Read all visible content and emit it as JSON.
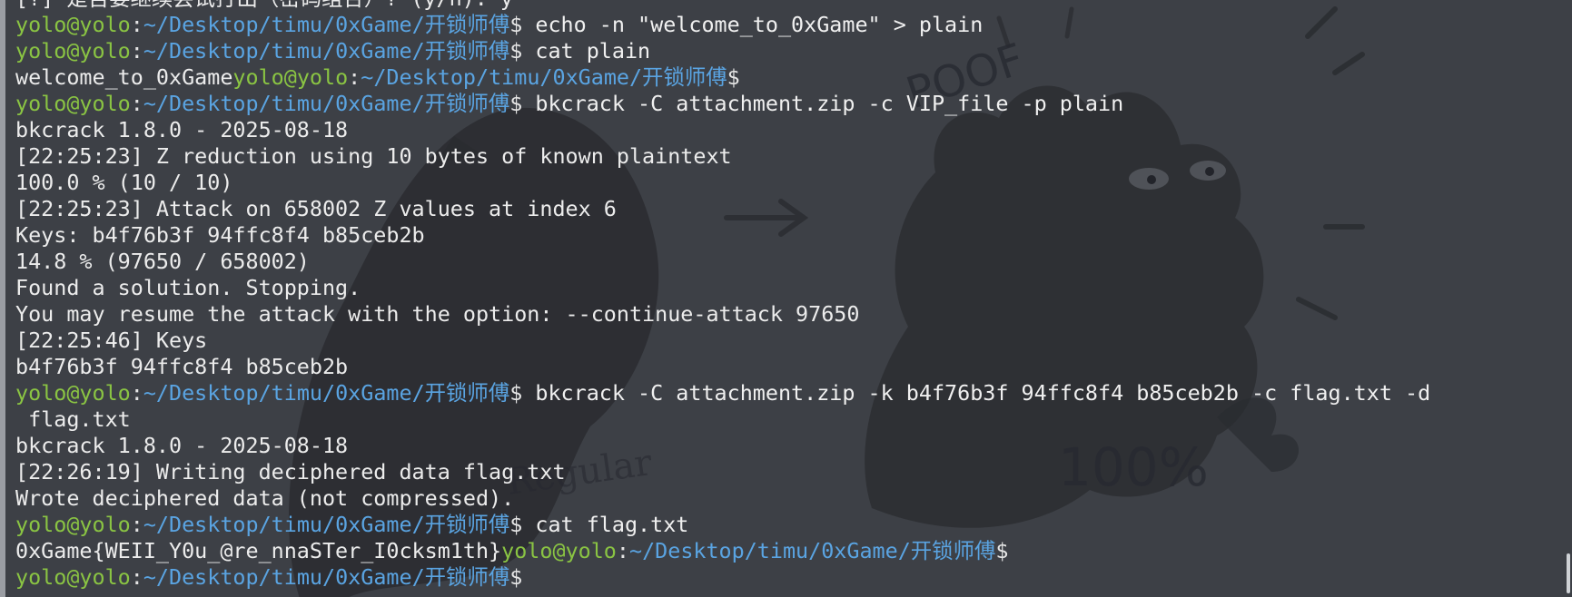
{
  "prompt": {
    "user_host": "yolo@yolo",
    "separator": ":",
    "path": "~/Desktop/timu/0xGame/开锁师傅",
    "symbol": "$"
  },
  "lines": [
    {
      "type": "text",
      "text": "[?] 是否要继续尝试打出（密码组合）? (y/n): y"
    },
    {
      "type": "prompt",
      "cmd": " echo -n \"welcome_to_0xGame\" > plain"
    },
    {
      "type": "prompt",
      "cmd": " cat plain"
    },
    {
      "type": "output_prompt",
      "text": "welcome_to_0xGame",
      "cmd": ""
    },
    {
      "type": "prompt",
      "cmd": " bkcrack -C attachment.zip -c VIP_file -p plain"
    },
    {
      "type": "text",
      "text": "bkcrack 1.8.0 - 2025-08-18"
    },
    {
      "type": "text",
      "text": "[22:25:23] Z reduction using 10 bytes of known plaintext"
    },
    {
      "type": "text",
      "text": "100.0 % (10 / 10)"
    },
    {
      "type": "text",
      "text": "[22:25:23] Attack on 658002 Z values at index 6"
    },
    {
      "type": "text",
      "text": "Keys: b4f76b3f 94ffc8f4 b85ceb2b"
    },
    {
      "type": "text",
      "text": "14.8 % (97650 / 658002)"
    },
    {
      "type": "text",
      "text": "Found a solution. Stopping."
    },
    {
      "type": "text",
      "text": "You may resume the attack with the option: --continue-attack 97650"
    },
    {
      "type": "text",
      "text": "[22:25:46] Keys"
    },
    {
      "type": "text",
      "text": "b4f76b3f 94ffc8f4 b85ceb2b"
    },
    {
      "type": "prompt",
      "cmd": " bkcrack -C attachment.zip -k b4f76b3f 94ffc8f4 b85ceb2b -c flag.txt -d"
    },
    {
      "type": "text",
      "text": " flag.txt"
    },
    {
      "type": "text",
      "text": "bkcrack 1.8.0 - 2025-08-18"
    },
    {
      "type": "text",
      "text": "[22:26:19] Writing deciphered data flag.txt"
    },
    {
      "type": "text",
      "text": "Wrote deciphered data (not compressed)."
    },
    {
      "type": "prompt",
      "cmd": " cat flag.txt"
    },
    {
      "type": "output_prompt",
      "text": "0xGame{WEII_Y0u_@re_nnaSTer_I0cksm1th}",
      "cmd": ""
    },
    {
      "type": "prompt",
      "cmd": ""
    }
  ],
  "background_doodle": {
    "words": [
      "POOF",
      "100%",
      "Regular"
    ]
  },
  "colors": {
    "background": "#3d4046",
    "user_host": "#8ac443",
    "path": "#5aa4e2",
    "text": "#ececec"
  }
}
